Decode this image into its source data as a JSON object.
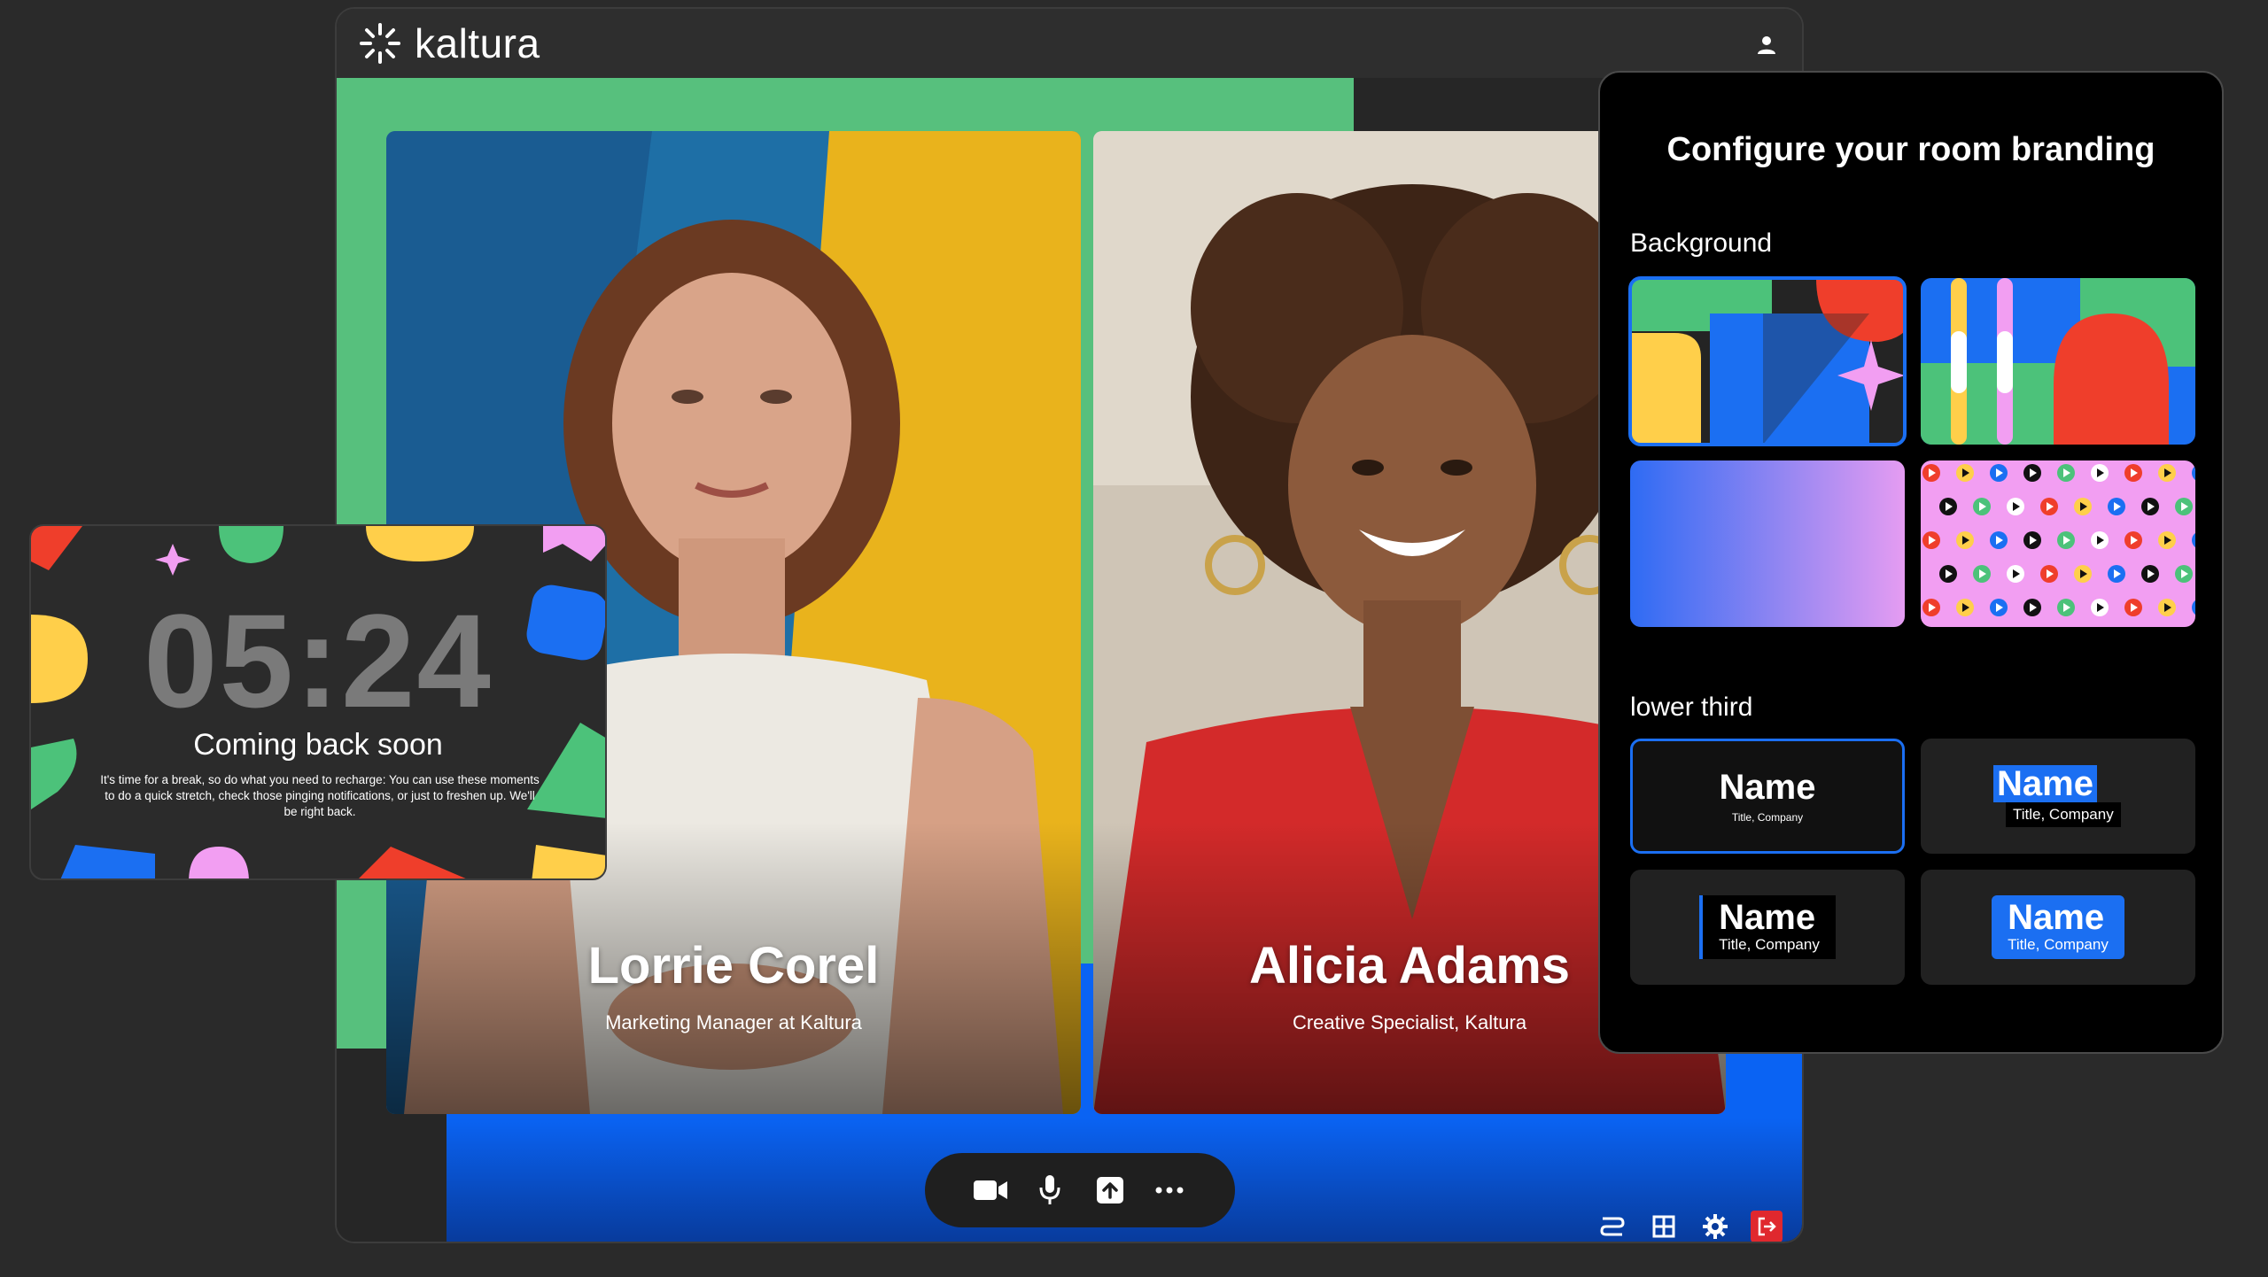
{
  "app": {
    "name": "kaltura"
  },
  "participants": [
    {
      "name": "Lorrie Corel",
      "title": "Marketing Manager at Kaltura"
    },
    {
      "name": "Alicia Adams",
      "title": "Creative Specialist, Kaltura"
    }
  ],
  "break_screen": {
    "timer": "05:24",
    "title": "Coming back soon",
    "message": "It's time for a break, so do what you need to recharge: You can use these moments to do a quick stretch, check those pinging notifications, or just to freshen up. We'll be right back."
  },
  "branding_panel": {
    "title": "Configure your room branding",
    "background_label": "Background",
    "lower_third_label": "lower third",
    "lower_thirds": [
      {
        "name": "Name",
        "sub": "Title, Company"
      },
      {
        "name": "Name",
        "sub": "Title, Company"
      },
      {
        "name": "Name",
        "sub": "Title, Company"
      },
      {
        "name": "Name",
        "sub": "Title, Company"
      }
    ]
  },
  "colors": {
    "accent_blue": "#0a63f3",
    "stage_green": "#57c07d",
    "leave_red": "#e0282e"
  }
}
